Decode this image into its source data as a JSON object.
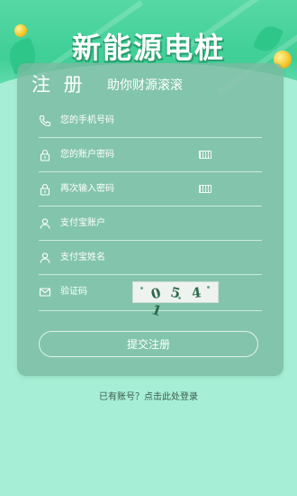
{
  "header": {
    "title": "新能源电桩"
  },
  "form": {
    "title": "注 册",
    "subtitle": "助你财源滚滚",
    "fields": [
      {
        "name": "phone",
        "icon": "phone-icon",
        "placeholder": "您的手机号码",
        "value": ""
      },
      {
        "name": "password",
        "icon": "lock-icon",
        "placeholder": "您的账户密码",
        "value": ""
      },
      {
        "name": "password_confirm",
        "icon": "lock-icon",
        "placeholder": "再次输入密码",
        "value": ""
      },
      {
        "name": "alipay_account",
        "icon": "user-icon",
        "placeholder": "支付宝账户",
        "value": ""
      },
      {
        "name": "alipay_name",
        "icon": "user-icon",
        "placeholder": "支付宝姓名",
        "value": ""
      },
      {
        "name": "captcha",
        "icon": "mail-icon",
        "placeholder": "验证码",
        "value": ""
      }
    ],
    "captcha_chars": [
      "0",
      "5",
      "4",
      "1"
    ],
    "submit_label": "提交注册"
  },
  "footer": {
    "login_link": "已有账号？点击此处登录"
  },
  "colors": {
    "background": "#a6efd6",
    "header_green": "#3fcf96",
    "card": "#7ab9a0",
    "text_on_card": "#ffffff"
  }
}
